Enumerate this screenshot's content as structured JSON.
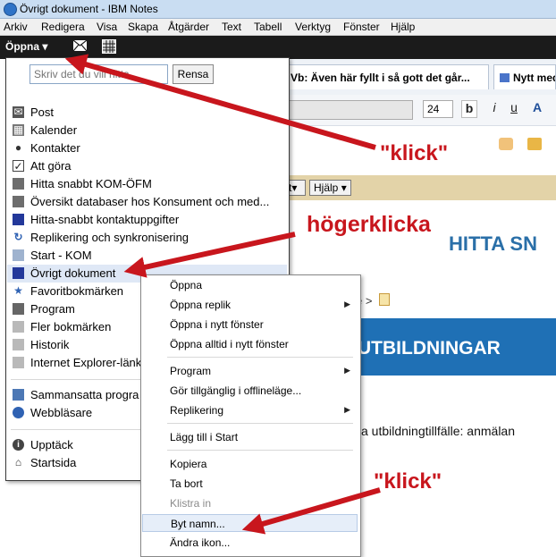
{
  "window": {
    "title": "Övrigt dokument - IBM Notes"
  },
  "menubar": {
    "items": [
      "Arkiv",
      "Redigera",
      "Visa",
      "Skapa",
      "Åtgärder",
      "Text",
      "Tabell",
      "Verktyg",
      "Fönster",
      "Hjälp"
    ]
  },
  "toolbar": {
    "open_label": "Öppna"
  },
  "tabs": [
    {
      "label": "Vb: Även här fyllt i så gott det går..."
    },
    {
      "label": "Nytt med"
    }
  ],
  "format": {
    "font_size": "24",
    "bold": "b",
    "italic": "i",
    "underline": "u"
  },
  "actions": {
    "hjalp_label": "Hjälp",
    "partial_label": "t"
  },
  "content": {
    "heading": "HITTA SN",
    "breadcrumb_sep": "e >",
    "banner": "UTBILDNINGAR",
    "body": "a utbildningtillfälle: anmälan"
  },
  "menu": {
    "search_placeholder": "Skriv det du vill hitta",
    "clear_label": "Rensa",
    "items": [
      {
        "label": "Post",
        "icon": "mail-icon"
      },
      {
        "label": "Kalender",
        "icon": "calendar-icon"
      },
      {
        "label": "Kontakter",
        "icon": "contacts-icon"
      },
      {
        "label": "Att göra",
        "icon": "todo-icon"
      },
      {
        "label": "Hitta snabbt KOM-ÖFM",
        "icon": "database-icon"
      },
      {
        "label": "Översikt databaser hos Konsument och med...",
        "icon": "database-icon"
      },
      {
        "label": "Hitta-snabbt kontaktuppgifter",
        "icon": "database-icon"
      },
      {
        "label": "Replikering och synkronisering",
        "icon": "replication-icon"
      },
      {
        "label": "Start - KOM",
        "icon": "home-page-icon"
      },
      {
        "label": "Övrigt dokument",
        "icon": "document-icon"
      },
      {
        "label": "Favoritbokmärken",
        "icon": "favorites-icon"
      },
      {
        "label": "Program",
        "icon": "applications-icon"
      },
      {
        "label": "Fler bokmärken",
        "icon": "folder-icon"
      },
      {
        "label": "Historik",
        "icon": "history-icon"
      },
      {
        "label": "Internet Explorer-länk",
        "icon": "ie-link-icon"
      },
      {
        "label": "Sammansatta progra",
        "icon": "composite-icon"
      },
      {
        "label": "Webbläsare",
        "icon": "browser-icon"
      },
      {
        "label": "Upptäck",
        "icon": "info-icon"
      },
      {
        "label": "Startsida",
        "icon": "home-icon"
      }
    ]
  },
  "context_menu": {
    "items": [
      {
        "label": "Öppna",
        "submenu": false,
        "disabled": false
      },
      {
        "label": "Öppna replik",
        "submenu": true,
        "disabled": false
      },
      {
        "label": "Öppna i nytt fönster",
        "submenu": false,
        "disabled": false
      },
      {
        "label": "Öppna alltid i nytt fönster",
        "submenu": false,
        "disabled": false
      },
      {
        "label": "Program",
        "submenu": true,
        "disabled": false
      },
      {
        "label": "Gör tillgänglig i offlineläge...",
        "submenu": false,
        "disabled": false
      },
      {
        "label": "Replikering",
        "submenu": true,
        "disabled": false
      },
      {
        "label": "Lägg till i Start",
        "submenu": false,
        "disabled": false
      },
      {
        "label": "Kopiera",
        "submenu": false,
        "disabled": false
      },
      {
        "label": "Ta bort",
        "submenu": false,
        "disabled": false
      },
      {
        "label": "Klistra in",
        "submenu": false,
        "disabled": true
      },
      {
        "label": "Byt namn...",
        "submenu": false,
        "disabled": false
      },
      {
        "label": "Ändra ikon...",
        "submenu": false,
        "disabled": false
      }
    ]
  },
  "annotations": {
    "klick1": "\"klick\"",
    "hogerklicka": "högerklicka",
    "klick2": "\"klick\"",
    "color": "#c8161d"
  }
}
